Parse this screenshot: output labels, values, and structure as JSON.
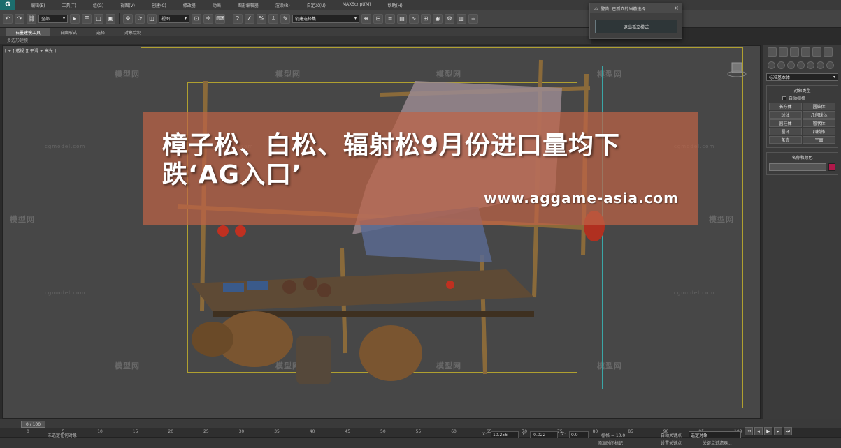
{
  "app": {
    "logo": "G"
  },
  "menu": [
    "编辑(E)",
    "工具(T)",
    "组(G)",
    "视图(V)",
    "创建(C)",
    "修改器",
    "动画",
    "图形编辑器",
    "渲染(R)",
    "自定义(U)",
    "MAXScript(M)",
    "帮助(H)"
  ],
  "toolbar": {
    "selection_filter": "全部",
    "view_select": "视图",
    "named_selection": "创建选择集"
  },
  "ribbon": {
    "tabs": [
      "石墨建模工具",
      "自由形式",
      "选择",
      "对象绘制"
    ],
    "active_tab": "石墨建模工具",
    "sub_label": "多边形建模"
  },
  "popup": {
    "title": "警告: 已孤立的当前选择",
    "close": "×",
    "button_label": "退出孤立模式"
  },
  "viewport": {
    "label": "[ + ] 透视 ][ 平滑 + 高光 ]",
    "watermark_brand": "模型网",
    "watermark_site": "cgmodel.com"
  },
  "banner": {
    "title": "樟子松、白松、辐射松9月份进口量均下跌‘AG入口’",
    "url": "www.aggame-asia.com"
  },
  "command_panel": {
    "dropdown": "标准基本体",
    "rollout_object_type": "对象类型",
    "autogrid": "自动栅格",
    "objects": [
      "长方体",
      "圆锥体",
      "球体",
      "几何球体",
      "圆柱体",
      "管状体",
      "圆环",
      "四棱锥",
      "茶壶",
      "平面"
    ],
    "rollout_name_color": "名称和颜色",
    "accent_color": "#b0184a"
  },
  "timeline": {
    "slider": "0 / 100",
    "ticks": [
      "0",
      "5",
      "10",
      "15",
      "20",
      "25",
      "30",
      "35",
      "40",
      "45",
      "50",
      "55",
      "60",
      "65",
      "70",
      "75",
      "80",
      "85",
      "90",
      "95",
      "100"
    ]
  },
  "status": {
    "message": "未选定任何对象",
    "x_label": "X:",
    "x": "10.256",
    "y_label": "Y:",
    "y": "-0.022",
    "z_label": "Z:",
    "z": "0.0",
    "grid": "栅格 = 10.0",
    "auto_key": "自动关键点",
    "selected": "选定对象",
    "set_key": "设置关键点",
    "key_filter": "关键点过滤器...",
    "add_time_tag": "添加时间标记"
  }
}
